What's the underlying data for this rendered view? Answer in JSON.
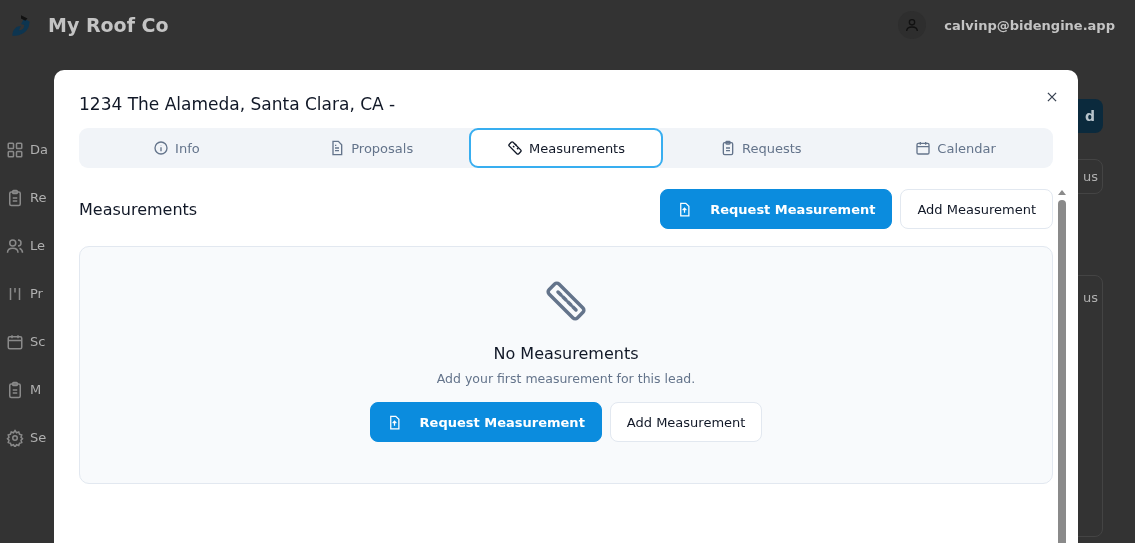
{
  "header": {
    "brand": "My Roof Co",
    "user_email": "calvinp@bidengine.app"
  },
  "sidebar": {
    "items": [
      {
        "label": "Da"
      },
      {
        "label": "Re"
      },
      {
        "label": "Le"
      },
      {
        "label": "Pr"
      },
      {
        "label": "Sc"
      },
      {
        "label": "M"
      },
      {
        "label": "Se"
      }
    ]
  },
  "page_controls": [
    {
      "label": "d",
      "kind": "primary"
    },
    {
      "label": "us",
      "kind": "outline"
    },
    {
      "label": "us",
      "kind": "card"
    }
  ],
  "dialog": {
    "title": "1234 The Alameda, Santa Clara, CA -",
    "tabs": [
      {
        "label": "Info",
        "selected": false
      },
      {
        "label": "Proposals",
        "selected": false
      },
      {
        "label": "Measurements",
        "selected": true
      },
      {
        "label": "Requests",
        "selected": false
      },
      {
        "label": "Calendar",
        "selected": false
      }
    ],
    "section_title": "Measurements",
    "actions": [
      {
        "label": "Request Measurement",
        "kind": "primary"
      },
      {
        "label": "Add Measurement",
        "kind": "secondary"
      }
    ],
    "empty_state": {
      "title": "No Measurements",
      "message": "Add your first measurement for this lead.",
      "actions": [
        {
          "label": "Request Measurement",
          "kind": "primary"
        },
        {
          "label": "Add Measurement",
          "kind": "secondary"
        }
      ]
    }
  }
}
